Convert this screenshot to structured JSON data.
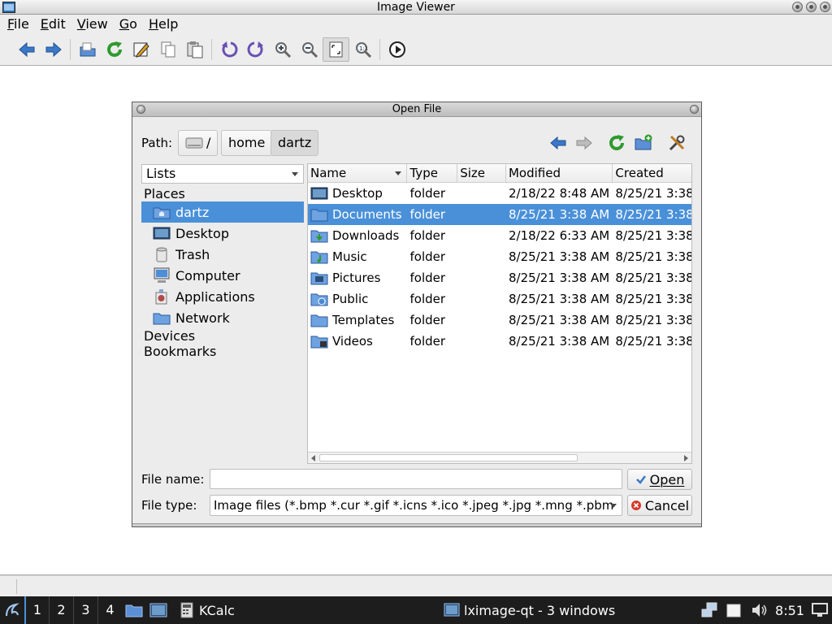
{
  "window": {
    "title": "Image Viewer"
  },
  "menubar": [
    {
      "label": "File",
      "u": "F",
      "rest": "ile"
    },
    {
      "label": "Edit",
      "u": "E",
      "rest": "dit"
    },
    {
      "label": "View",
      "u": "V",
      "rest": "iew"
    },
    {
      "label": "Go",
      "u": "G",
      "rest": "o"
    },
    {
      "label": "Help",
      "u": "H",
      "rest": "elp"
    }
  ],
  "toolbar": [
    "back-icon",
    "forward-icon",
    "open-file-icon",
    "reload-icon",
    "edit-icon",
    "copy-icon",
    "paste-icon",
    "rotate-ccw-icon",
    "rotate-cw-icon",
    "zoom-in-icon",
    "zoom-out-icon",
    "fit-window-icon",
    "original-size-icon",
    "slideshow-icon"
  ],
  "dialog": {
    "title": "Open File",
    "path_label": "Path:",
    "path": [
      {
        "label": "/"
      },
      {
        "label": "home"
      },
      {
        "label": "dartz"
      }
    ],
    "view_combo": "Lists",
    "sections": {
      "places": "Places",
      "devices": "Devices",
      "bookmarks": "Bookmarks"
    },
    "places": [
      {
        "label": "dartz",
        "icon": "home-folder-icon",
        "selected": true
      },
      {
        "label": "Desktop",
        "icon": "desktop-icon",
        "selected": false
      },
      {
        "label": "Trash",
        "icon": "trash-icon",
        "selected": false
      },
      {
        "label": "Computer",
        "icon": "computer-icon",
        "selected": false
      },
      {
        "label": "Applications",
        "icon": "applications-icon",
        "selected": false
      },
      {
        "label": "Network",
        "icon": "network-folder-icon",
        "selected": false
      }
    ],
    "columns": {
      "name": "Name",
      "type": "Type",
      "size": "Size",
      "modified": "Modified",
      "created": "Created"
    },
    "files": [
      {
        "name": "Desktop",
        "type": "folder",
        "size": "",
        "modified": "2/18/22 8:48 AM",
        "created": "8/25/21 3:38",
        "icon": "desktop-folder-icon",
        "selected": false
      },
      {
        "name": "Documents",
        "type": "folder",
        "size": "",
        "modified": "8/25/21 3:38 AM",
        "created": "8/25/21 3:38",
        "icon": "folder-icon",
        "selected": true
      },
      {
        "name": "Downloads",
        "type": "folder",
        "size": "",
        "modified": "2/18/22 6:33 AM",
        "created": "8/25/21 3:38",
        "icon": "downloads-folder-icon",
        "selected": false
      },
      {
        "name": "Music",
        "type": "folder",
        "size": "",
        "modified": "8/25/21 3:38 AM",
        "created": "8/25/21 3:38",
        "icon": "music-folder-icon",
        "selected": false
      },
      {
        "name": "Pictures",
        "type": "folder",
        "size": "",
        "modified": "8/25/21 3:38 AM",
        "created": "8/25/21 3:38",
        "icon": "pictures-folder-icon",
        "selected": false
      },
      {
        "name": "Public",
        "type": "folder",
        "size": "",
        "modified": "8/25/21 3:38 AM",
        "created": "8/25/21 3:38",
        "icon": "public-folder-icon",
        "selected": false
      },
      {
        "name": "Templates",
        "type": "folder",
        "size": "",
        "modified": "8/25/21 3:38 AM",
        "created": "8/25/21 3:38",
        "icon": "templates-folder-icon",
        "selected": false
      },
      {
        "name": "Videos",
        "type": "folder",
        "size": "",
        "modified": "8/25/21 3:38 AM",
        "created": "8/25/21 3:38",
        "icon": "videos-folder-icon",
        "selected": false
      }
    ],
    "file_name_label": "File name:",
    "file_name_value": "",
    "file_type_label": "File type:",
    "file_type_value": "Image files (*.bmp *.cur *.gif *.icns *.ico *.jpeg *.jpg *.mng *.pbm",
    "open_label": "Open",
    "cancel_label": "Cancel"
  },
  "taskbar": {
    "desktops": [
      "1",
      "2",
      "3",
      "4"
    ],
    "kcalc_label": "KCalc",
    "task_label": "lximage-qt - 3 windows",
    "clock": "8:51"
  },
  "colors": {
    "selection": "#4a90d9",
    "taskbar": "#1d1d1d",
    "accent_green": "#2e9a2e"
  }
}
